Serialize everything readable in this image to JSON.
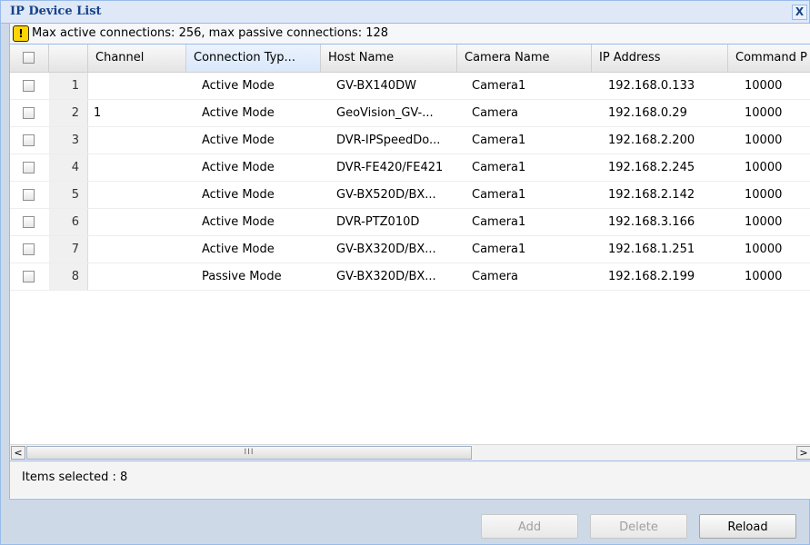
{
  "window": {
    "title": "IP Device List",
    "close_label": "X"
  },
  "info": {
    "icon": "warning-icon",
    "text": "Max active connections: 256, max passive connections: 128"
  },
  "columns": [
    "Channel",
    "Connection Typ...",
    "Host Name",
    "Camera Name",
    "IP Address",
    "Command P"
  ],
  "rows": [
    {
      "num": "1",
      "channel": "",
      "connection": "Active Mode",
      "host": "GV-BX140DW",
      "camera": "Camera1",
      "ip": "192.168.0.133",
      "port": "10000"
    },
    {
      "num": "2",
      "channel": "1",
      "connection": "Active Mode",
      "host": "GeoVision_GV-...",
      "camera": "Camera",
      "ip": "192.168.0.29",
      "port": "10000"
    },
    {
      "num": "3",
      "channel": "",
      "connection": "Active Mode",
      "host": "DVR-IPSpeedDo...",
      "camera": "Camera1",
      "ip": "192.168.2.200",
      "port": "10000"
    },
    {
      "num": "4",
      "channel": "",
      "connection": "Active Mode",
      "host": "DVR-FE420/FE421",
      "camera": "Camera1",
      "ip": "192.168.2.245",
      "port": "10000"
    },
    {
      "num": "5",
      "channel": "",
      "connection": "Active Mode",
      "host": "GV-BX520D/BX...",
      "camera": "Camera1",
      "ip": "192.168.2.142",
      "port": "10000"
    },
    {
      "num": "6",
      "channel": "",
      "connection": "Active Mode",
      "host": "DVR-PTZ010D",
      "camera": "Camera1",
      "ip": "192.168.3.166",
      "port": "10000"
    },
    {
      "num": "7",
      "channel": "",
      "connection": "Active Mode",
      "host": "GV-BX320D/BX...",
      "camera": "Camera1",
      "ip": "192.168.1.251",
      "port": "10000"
    },
    {
      "num": "8",
      "channel": "",
      "connection": "Passive Mode",
      "host": "GV-BX320D/BX...",
      "camera": "Camera",
      "ip": "192.168.2.199",
      "port": "10000"
    }
  ],
  "scrollbar": {
    "left_arrow": "<",
    "right_arrow": ">",
    "thumb_grip": "III"
  },
  "status": {
    "text": "Items selected : 8"
  },
  "buttons": {
    "add": "Add",
    "delete": "Delete",
    "reload": "Reload"
  }
}
